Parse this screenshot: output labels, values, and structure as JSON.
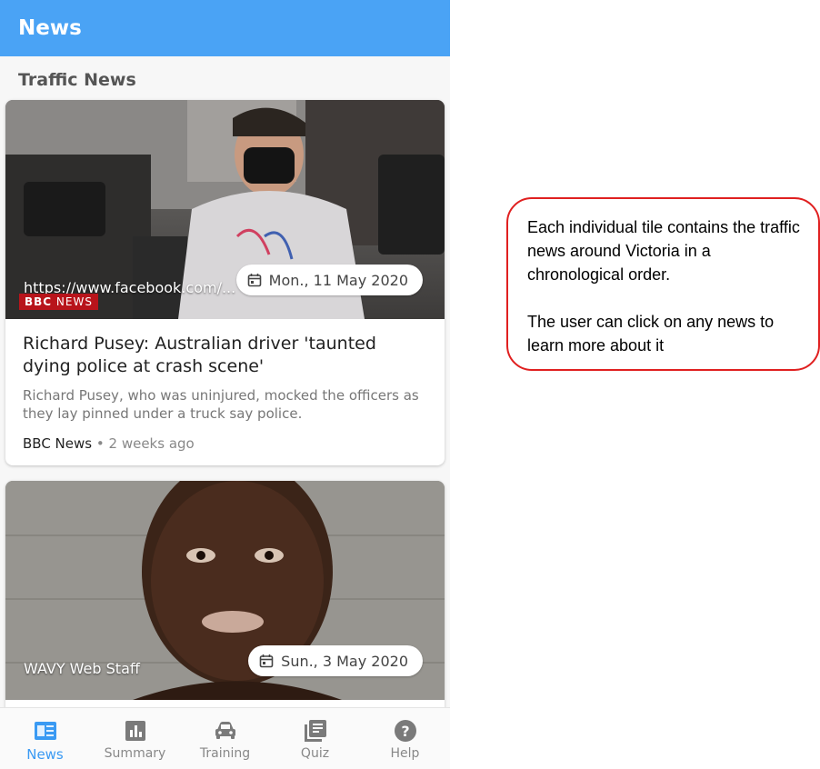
{
  "app": {
    "title": "News"
  },
  "section": {
    "title": "Traffic News"
  },
  "articles": [
    {
      "source_url": "https://www.facebook.com/...",
      "publisher_logo": "BBC NEWS",
      "date": "Mon., 11 May 2020",
      "title": "Richard Pusey: Australian driver 'taunted dying police at crash scene'",
      "description": "Richard Pusey, who was uninjured, mocked the officers as they lay pinned under a truck say police.",
      "publisher": "BBC News",
      "separator": "•",
      "age": "2 weeks ago"
    },
    {
      "source_label": "WAVY Web Staff",
      "date": "Sun., 3 May 2020"
    }
  ],
  "nav": {
    "items": [
      {
        "label": "News",
        "icon": "news-icon",
        "active": true
      },
      {
        "label": "Summary",
        "icon": "bar-chart-icon",
        "active": false
      },
      {
        "label": "Training",
        "icon": "car-icon",
        "active": false
      },
      {
        "label": "Quiz",
        "icon": "quiz-library-icon",
        "active": false
      },
      {
        "label": "Help",
        "icon": "help-icon",
        "active": false
      }
    ]
  },
  "annotation": {
    "paragraph1": "Each individual tile contains the traffic news around Victoria in a chronological order.",
    "paragraph2": "The user can click on any news to learn more about it"
  },
  "colors": {
    "appbar": "#4aa3f5",
    "active_nav": "#3a9af3",
    "callout_border": "#e02020",
    "bbc_red": "#b8141b"
  }
}
